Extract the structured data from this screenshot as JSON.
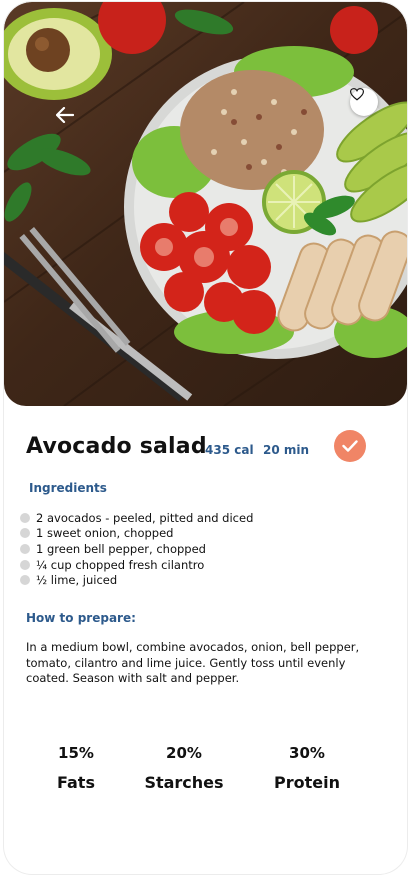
{
  "recipe": {
    "title": "Avocado salad",
    "calories": "435 cal",
    "time": "20 min"
  },
  "sections": {
    "ingredients_title": "Ingredients",
    "prepare_title": "How to prepare:"
  },
  "ingredients": [
    "2 avocados - peeled, pitted and diced",
    "1 sweet onion, chopped",
    "1 green bell pepper, chopped",
    "¼ cup chopped fresh cilantro",
    "½ lime, juiced"
  ],
  "instructions": "In a medium bowl, combine avocados, onion, bell pepper, tomato, cilantro and lime juice. Gently toss until evenly coated. Season with salt and pepper.",
  "nutrition": [
    {
      "percent": "15%",
      "label": "Fats"
    },
    {
      "percent": "20%",
      "label": "Starches"
    },
    {
      "percent": "30%",
      "label": "Protein"
    }
  ],
  "icons": {
    "back": "back-arrow-icon",
    "favorite": "heart-icon",
    "done": "check-icon"
  },
  "colors": {
    "accent": "#f08566",
    "section_heading": "#2d5a8c"
  }
}
